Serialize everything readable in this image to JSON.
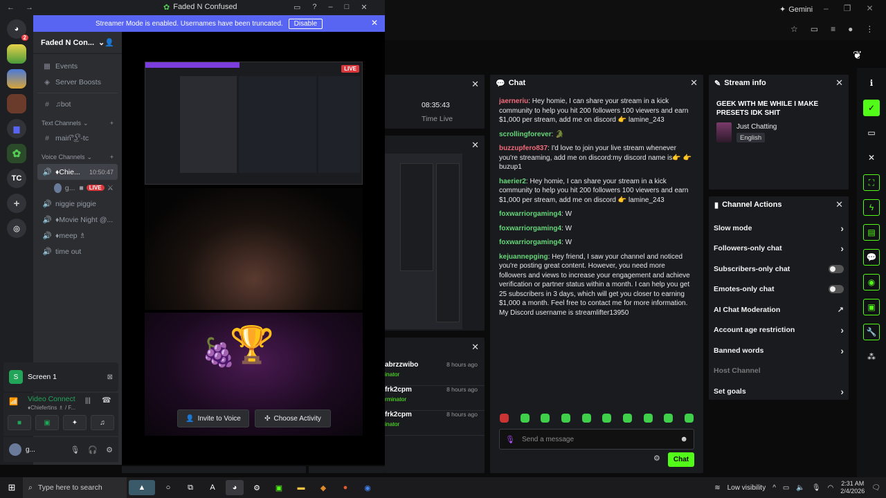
{
  "browser": {
    "gemini_label": "Gemini"
  },
  "stats": {
    "uptime": "08:35:43",
    "uptime_label": "Time Live"
  },
  "chat": {
    "title": "Chat",
    "messages": [
      {
        "user": "jaerneriu",
        "color": "#f26b7a",
        "text": ": Hey homie, I can share your stream in a kick community to help you hit 200 followers 100 viewers and earn $1,000 per stream, add me on discord 👉 lamine_243"
      },
      {
        "user": "scrollingforever",
        "color": "#67d87a",
        "text": ": 🐊"
      },
      {
        "user": "buzzupfero837",
        "color": "#f26b7a",
        "text": ": I'd love to join your live stream whenever you're streaming, add me on discord:my discord name is👉 👉 buzup1"
      },
      {
        "user": "haerier2",
        "color": "#67d87a",
        "text": ": Hey homie, I can share your stream in a kick community to help you hit 200 followers 100 viewers and earn $1,000 per stream, add me on discord 👉 lamine_243"
      },
      {
        "user": "foxwarriorgaming4",
        "color": "#67d87a",
        "text": ": W"
      },
      {
        "user": "foxwarriorgaming4",
        "color": "#67d87a",
        "text": ": W"
      },
      {
        "user": "foxwarriorgaming4",
        "color": "#67d87a",
        "text": ": W"
      },
      {
        "user": "kejuannepging",
        "color": "#67d87a",
        "text": ": Hey friend, I saw your channel and noticed you're posting great content. However, you need more followers and views to increase your engagement and achieve verification or partner status within a month. I can help you get 25 subscribers in 3 days, which will get you closer to earning $1,000 a month. Feel free to contact me for more information. My Discord username is streamlifter13950"
      }
    ],
    "input_placeholder": "Send a message",
    "send_label": "Chat"
  },
  "activity": {
    "items": [
      {
        "name": "abrzzwibo",
        "sub": "inator",
        "time": "8 hours ago"
      },
      {
        "name": "frk2cpm",
        "sub": "rminator",
        "time": "8 hours ago"
      },
      {
        "name": "frk2cpm",
        "sub": "inator",
        "time": "8 hours ago"
      }
    ]
  },
  "stream_info": {
    "title": "Stream info",
    "stream_title": "GEEK WITH ME WHILE I MAKE PRESETS IDK SHIT",
    "category": "Just Chatting",
    "language": "English"
  },
  "channel_actions": {
    "title": "Channel Actions",
    "rows": [
      {
        "label": "Slow mode",
        "control": "chevron"
      },
      {
        "label": "Followers-only chat",
        "control": "chevron"
      },
      {
        "label": "Subscribers-only chat",
        "control": "toggle"
      },
      {
        "label": "Emotes-only chat",
        "control": "toggle"
      },
      {
        "label": "AI Chat Moderation",
        "control": "external"
      },
      {
        "label": "Account age restriction",
        "control": "chevron"
      },
      {
        "label": "Banned words",
        "control": "chevron"
      },
      {
        "label": "Host Channel",
        "control": "none"
      },
      {
        "label": "Set goals",
        "control": "chevron"
      }
    ]
  },
  "discord": {
    "window_title": "Faded N Confused",
    "banner_text": "Streamer Mode is enabled. Usernames have been truncated.",
    "banner_button": "Disable",
    "server_name": "Faded N Con...",
    "notif_badge": "2",
    "guild_tc": "TC",
    "menu": [
      {
        "icon": "calendar-icon",
        "label": "Events"
      },
      {
        "icon": "boost-icon",
        "label": "Server Boosts"
      }
    ],
    "bot_channel": "♫bot",
    "text_channels_label": "Text Channels",
    "text_channel": "main͡°͜ʖ͡°-tc",
    "voice_channels_label": "Voice Channels",
    "active_voice": "♦Chie...",
    "active_voice_time": "10:50:47",
    "voice_user": "g...",
    "live_badge": "LIVE",
    "voice_channels": [
      "niggie piggie",
      "♦Movie Night @...",
      "♦meep ♗",
      "time out"
    ],
    "screen_label": "Screen 1",
    "video_connected": "Video Connect",
    "video_sub": "♦Chiefertins ♗ / F...",
    "user_name": "g...",
    "invite_label": "Invite to Voice",
    "activity_label": "Choose Activity",
    "stream_live": "LIVE"
  },
  "taskbar": {
    "search_placeholder": "Type here to search",
    "visibility": "Low visibility",
    "time": "2:31 AM",
    "date": "2/4/2026"
  }
}
